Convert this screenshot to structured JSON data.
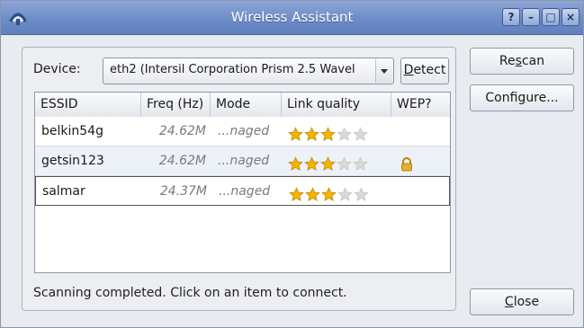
{
  "window": {
    "title": "Wireless Assistant",
    "buttons": {
      "help": "?",
      "minimize": "–",
      "maximize": "□",
      "close": "×"
    }
  },
  "device": {
    "label": "Device:",
    "selected": "eth2 (Intersil Corporation Prism 2.5 Wavel",
    "detect_label_prefix": "",
    "detect_label_underlined": "D",
    "detect_label_rest": "etect"
  },
  "table": {
    "headers": [
      "ESSID",
      "Freq (Hz)",
      "Mode",
      "Link quality",
      "WEP?"
    ],
    "rows": [
      {
        "essid": "belkin54g",
        "freq": "24.62M",
        "mode": "...naged",
        "stars": 3,
        "wep": false
      },
      {
        "essid": "getsin123",
        "freq": "24.62M",
        "mode": "...naged",
        "stars": 3,
        "wep": true
      },
      {
        "essid": "salmar",
        "freq": "24.37M",
        "mode": "...naged",
        "stars": 3,
        "wep": false
      }
    ]
  },
  "status": "Scanning completed.  Click on an item to connect.",
  "side_buttons": {
    "rescan_prefix": "Re",
    "rescan_underlined": "s",
    "rescan_rest": "can",
    "configure_prefix": "Confi",
    "configure_underlined": "g",
    "configure_rest": "ure...",
    "close_prefix": "",
    "close_underlined": "C",
    "close_rest": "lose"
  },
  "colors": {
    "titlebar": "#6d8cc8",
    "window_bg": "#e8ebf0",
    "star_fill": "#f3b500",
    "star_empty": "#d9d9d9",
    "lock": "#e3b12f"
  },
  "icons": {
    "app": "wireless-signal-icon",
    "lock": "lock-icon",
    "star": "star-icon"
  }
}
